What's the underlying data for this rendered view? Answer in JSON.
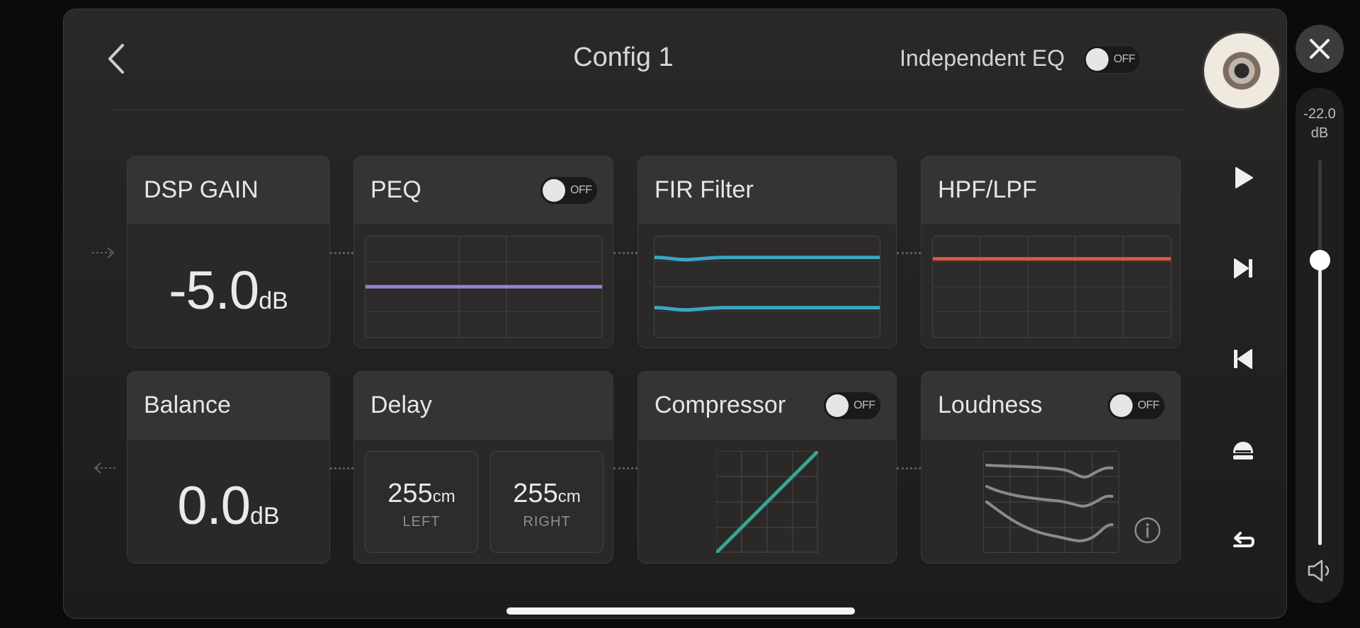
{
  "header": {
    "title": "Config 1",
    "independent_eq_label": "Independent EQ",
    "independent_eq_state": "OFF"
  },
  "cards": {
    "dsp_gain": {
      "title": "DSP GAIN",
      "value": "-5.0",
      "unit": "dB"
    },
    "peq": {
      "title": "PEQ",
      "state": "OFF",
      "line_color": "#9b7fd1"
    },
    "fir": {
      "title": "FIR Filter",
      "line_color": "#3aa7c4"
    },
    "hpf_lpf": {
      "title": "HPF/LPF",
      "line_color": "#e0573f"
    },
    "balance": {
      "title": "Balance",
      "value": "0.0",
      "unit": "dB"
    },
    "delay": {
      "title": "Delay",
      "left": {
        "value": "255",
        "unit": "cm",
        "label": "LEFT"
      },
      "right": {
        "value": "255",
        "unit": "cm",
        "label": "RIGHT"
      }
    },
    "compressor": {
      "title": "Compressor",
      "state": "OFF",
      "line_color": "#3aa391"
    },
    "loudness": {
      "title": "Loudness",
      "state": "OFF",
      "line_color": "#8a8a8a"
    }
  },
  "volume": {
    "value": "-22.0",
    "unit": "dB",
    "level_fraction": 0.74
  },
  "icons": {
    "back": "chevron-left-icon",
    "close": "close-icon",
    "play": "play-icon",
    "next": "skip-next-icon",
    "prev": "skip-previous-icon",
    "eject": "eject-icon",
    "return": "return-icon",
    "speaker": "speaker-icon",
    "info": "info-icon"
  }
}
